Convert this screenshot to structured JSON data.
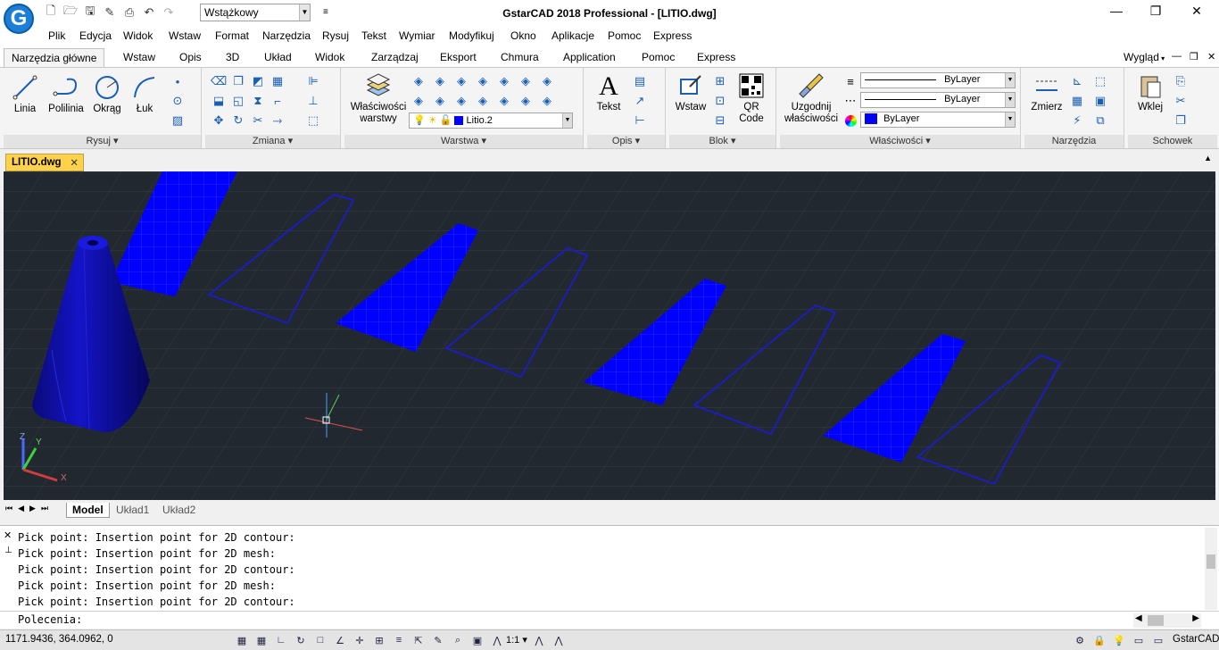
{
  "app": {
    "title": "GstarCAD 2018 Professional - [LITIO.dwg]",
    "logo_letter": "G",
    "workspace": "Wstążkowy",
    "win_buttons": {
      "min": "—",
      "restore": "❐",
      "close": "✕"
    }
  },
  "menu": [
    "Plik",
    "Edycja",
    "Widok",
    "Wstaw",
    "Format",
    "Narzędzia",
    "Rysuj",
    "Tekst",
    "Wymiar",
    "Modyfikuj",
    "Okno",
    "Aplikacje",
    "Pomoc",
    "Express"
  ],
  "ribbon_tabs": [
    "Narzędzia główne",
    "Wstaw",
    "Opis",
    "3D",
    "Układ",
    "Widok",
    "Zarządzaj",
    "Eksport",
    "Chmura",
    "Application",
    "Pomoc",
    "Express"
  ],
  "ribbon_right": {
    "label": "Wygląd"
  },
  "panels": {
    "rysuj": {
      "caption": "Rysuj",
      "buttons": [
        "Linia",
        "Polilinia",
        "Okrąg",
        "Łuk"
      ]
    },
    "zmiana": {
      "caption": "Zmiana"
    },
    "warstwa": {
      "caption": "Warstwa",
      "button": "Właściwości\nwarstwy",
      "btn_line1": "Właściwości",
      "btn_line2": "warstwy",
      "layer_value": "Litio.2"
    },
    "opis": {
      "caption": "Opis",
      "button": "Tekst"
    },
    "blok": {
      "caption": "Blok",
      "insert": "Wstaw",
      "qr_line1": "QR",
      "qr_line2": "Code"
    },
    "wlasciwosci": {
      "caption": "Właściwości",
      "match_line1": "Uzgodnij",
      "match_line2": "właściwości",
      "linetype": "ByLayer",
      "lineweight": "ByLayer",
      "color": "ByLayer"
    },
    "narzedzia": {
      "caption": "Narzędzia",
      "button": "Zmierz"
    },
    "schowek": {
      "caption": "Schowek",
      "button": "Wklej"
    }
  },
  "doc_tab": {
    "name": "LITIO.dwg",
    "close": "✕"
  },
  "axes": {
    "z": "Z",
    "y": "Y",
    "x": "X"
  },
  "layout_tabs": [
    "Model",
    "Układ1",
    "Układ2"
  ],
  "command_history": [
    "Pick point: Insertion point for 2D contour:",
    "Pick point: Insertion point for 2D mesh:",
    "Pick point: Insertion point for 2D contour:",
    "Pick point: Insertion point for 2D mesh:",
    "Pick point: Insertion point for 2D contour:"
  ],
  "command_prompt": "Polecenia:",
  "status": {
    "coords": "1171.9436, 364.0962, 0",
    "scale": "1:1",
    "brand": "GstarCAD"
  },
  "colors": {
    "accent": "#1c7ed6",
    "viewport": "#212830",
    "solid": "#0000ff",
    "tab_active": "#ffd24a"
  }
}
